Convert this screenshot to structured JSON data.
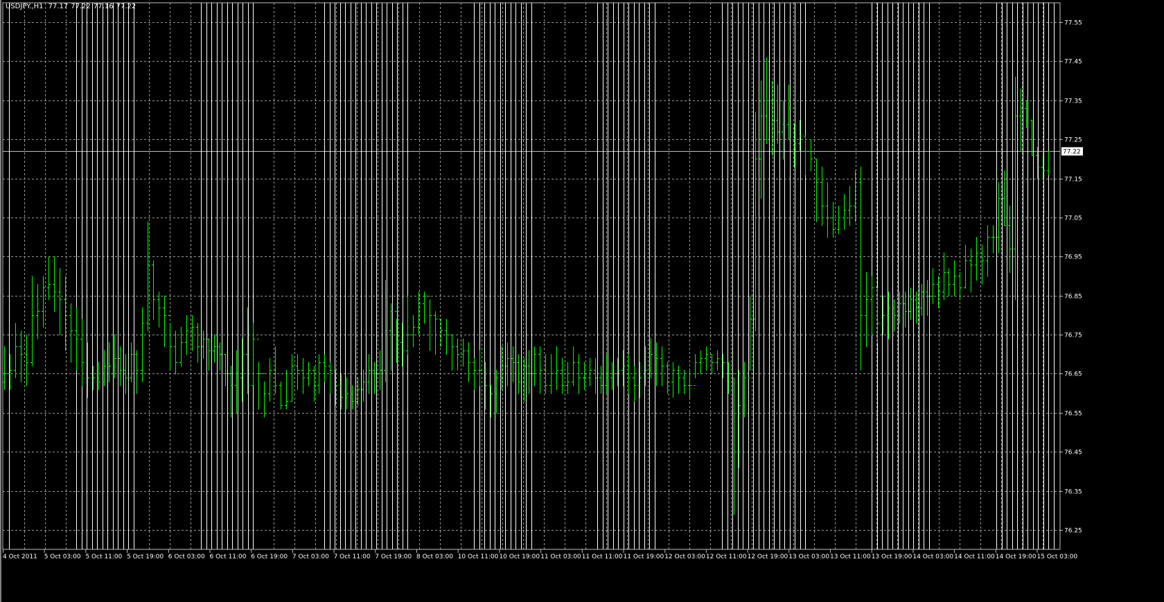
{
  "header": {
    "symbol": "USDJPY.,H1",
    "open": "77.17",
    "high": "77.22",
    "low": "77.16",
    "close": "77.22"
  },
  "colors": {
    "background": "#000000",
    "bar": "#00ff00",
    "grid": "#c0c0c0",
    "separator": "#ffffff",
    "bid_line": "#c0c0c0"
  },
  "chart_data": {
    "type": "ohlc",
    "title": "USDJPY.,H1",
    "ylim": [
      76.2,
      77.6
    ],
    "grid": true,
    "current_price": "77.22",
    "y_ticks": [
      "77.55",
      "77.45",
      "77.35",
      "77.25",
      "77.15",
      "77.05",
      "76.95",
      "76.85",
      "76.75",
      "76.65",
      "76.55",
      "76.45",
      "76.35",
      "76.25"
    ],
    "x_ticks": [
      "4 Oct 2011",
      "5 Oct 03:00",
      "5 Oct 11:00",
      "5 Oct 19:00",
      "6 Oct 03:00",
      "6 Oct 11:00",
      "6 Oct 19:00",
      "7 Oct 03:00",
      "7 Oct 11:00",
      "7 Oct 19:00",
      "8 Oct 03:00",
      "10 Oct 11:00",
      "10 Oct 19:00",
      "11 Oct 03:00",
      "11 Oct 11:00",
      "11 Oct 19:00",
      "12 Oct 03:00",
      "12 Oct 11:00",
      "12 Oct 19:00",
      "13 Oct 03:00",
      "13 Oct 11:00",
      "13 Oct 19:00",
      "14 Oct 03:00",
      "14 Oct 11:00",
      "14 Oct 19:00",
      "15 Oct 03:00"
    ],
    "first_open": 76.63,
    "bars_hlc": [
      [
        76.72,
        76.61,
        76.65
      ],
      [
        76.7,
        76.61,
        76.66
      ],
      [
        76.78,
        76.64,
        76.72
      ],
      [
        76.76,
        76.63,
        76.7
      ],
      [
        76.75,
        76.62,
        76.68
      ],
      [
        76.9,
        76.67,
        76.8
      ],
      [
        76.88,
        76.74,
        76.81
      ],
      [
        76.9,
        76.77,
        76.87
      ],
      [
        76.95,
        76.84,
        76.88
      ],
      [
        76.95,
        76.81,
        76.86
      ],
      [
        76.92,
        76.75,
        76.84
      ],
      [
        76.9,
        76.71,
        76.8
      ],
      [
        76.83,
        76.68,
        76.76
      ],
      [
        76.82,
        76.66,
        76.74
      ],
      [
        76.79,
        76.62,
        76.68
      ],
      [
        76.73,
        76.59,
        76.64
      ],
      [
        76.67,
        76.61,
        76.64
      ],
      [
        76.68,
        76.61,
        76.63
      ],
      [
        76.71,
        76.62,
        76.67
      ],
      [
        76.73,
        76.63,
        76.67
      ],
      [
        76.75,
        76.64,
        76.69
      ],
      [
        76.72,
        76.62,
        76.66
      ],
      [
        76.7,
        76.6,
        76.64
      ],
      [
        76.73,
        76.63,
        76.7
      ],
      [
        76.71,
        76.6,
        76.66
      ],
      [
        76.82,
        76.63,
        76.78
      ],
      [
        77.04,
        76.76,
        76.93
      ],
      [
        76.94,
        76.79,
        76.84
      ],
      [
        76.86,
        76.77,
        76.82
      ],
      [
        76.85,
        76.72,
        76.8
      ],
      [
        76.78,
        76.66,
        76.72
      ],
      [
        76.76,
        76.65,
        76.68
      ],
      [
        76.77,
        76.67,
        76.73
      ],
      [
        76.8,
        76.7,
        76.76
      ],
      [
        76.8,
        76.71,
        76.77
      ],
      [
        76.78,
        76.68,
        76.72
      ],
      [
        76.76,
        76.69,
        76.74
      ],
      [
        76.74,
        76.66,
        76.71
      ],
      [
        76.75,
        76.68,
        76.72
      ],
      [
        76.73,
        76.66,
        76.7
      ],
      [
        76.7,
        76.62,
        76.65
      ],
      [
        76.67,
        76.54,
        76.62
      ],
      [
        76.71,
        76.55,
        76.64
      ],
      [
        76.74,
        76.58,
        76.7
      ],
      [
        76.82,
        76.6,
        76.62
      ],
      [
        76.78,
        76.62,
        76.74
      ],
      [
        76.68,
        76.56,
        76.65
      ],
      [
        76.63,
        76.54,
        76.6
      ],
      [
        76.69,
        76.58,
        76.66
      ],
      [
        76.72,
        76.6,
        76.62
      ],
      [
        76.63,
        76.56,
        76.57
      ],
      [
        76.66,
        76.56,
        76.58
      ],
      [
        76.7,
        76.58,
        76.67
      ],
      [
        76.7,
        76.61,
        76.66
      ],
      [
        76.69,
        76.6,
        76.64
      ],
      [
        76.68,
        76.62,
        76.66
      ],
      [
        76.67,
        76.58,
        76.62
      ],
      [
        76.7,
        76.6,
        76.68
      ],
      [
        76.7,
        76.63,
        76.67
      ],
      [
        76.68,
        76.6,
        76.66
      ],
      [
        76.66,
        76.57,
        76.62
      ],
      [
        76.65,
        76.56,
        76.59
      ],
      [
        76.64,
        76.56,
        76.6
      ],
      [
        76.62,
        76.56,
        76.58
      ],
      [
        76.64,
        76.57,
        76.61
      ],
      [
        76.66,
        76.58,
        76.63
      ],
      [
        76.7,
        76.6,
        76.66
      ],
      [
        76.68,
        76.6,
        76.65
      ],
      [
        76.71,
        76.61,
        76.66
      ],
      [
        76.89,
        76.63,
        76.76
      ],
      [
        76.83,
        76.66,
        76.81
      ],
      [
        76.79,
        76.68,
        76.73
      ],
      [
        76.78,
        76.67,
        76.71
      ],
      [
        76.85,
        76.7,
        76.75
      ],
      [
        76.8,
        76.72,
        76.77
      ],
      [
        76.86,
        76.75,
        76.83
      ],
      [
        76.86,
        76.78,
        76.85
      ],
      [
        76.84,
        76.71,
        76.8
      ],
      [
        76.81,
        76.7,
        76.79
      ],
      [
        76.79,
        76.72,
        76.76
      ],
      [
        76.79,
        76.7,
        76.75
      ],
      [
        76.75,
        76.66,
        76.72
      ],
      [
        76.74,
        76.66,
        76.7
      ],
      [
        76.74,
        76.67,
        76.71
      ],
      [
        76.73,
        76.63,
        76.68
      ],
      [
        76.69,
        76.61,
        76.66
      ],
      [
        76.71,
        76.62,
        76.66
      ],
      [
        76.68,
        76.56,
        76.62
      ],
      [
        76.62,
        76.54,
        76.6
      ],
      [
        76.66,
        76.55,
        76.64
      ],
      [
        76.72,
        76.61,
        76.67
      ],
      [
        76.73,
        76.62,
        76.69
      ],
      [
        76.72,
        76.63,
        76.68
      ],
      [
        76.7,
        76.6,
        76.63
      ],
      [
        76.69,
        76.58,
        76.67
      ],
      [
        76.71,
        76.6,
        76.65
      ],
      [
        76.72,
        76.62,
        76.7
      ],
      [
        76.72,
        76.6,
        76.66
      ],
      [
        76.7,
        76.6,
        76.62
      ],
      [
        76.7,
        76.6,
        76.65
      ],
      [
        76.72,
        76.61,
        76.66
      ],
      [
        76.69,
        76.6,
        76.62
      ],
      [
        76.68,
        76.6,
        76.63
      ],
      [
        76.72,
        76.62,
        76.68
      ],
      [
        76.7,
        76.6,
        76.64
      ],
      [
        76.68,
        76.61,
        76.64
      ],
      [
        76.69,
        76.62,
        76.66
      ],
      [
        76.69,
        76.6,
        76.64
      ],
      [
        76.67,
        76.6,
        76.62
      ],
      [
        76.7,
        76.6,
        76.64
      ],
      [
        76.68,
        76.61,
        76.65
      ],
      [
        76.69,
        76.62,
        76.66
      ],
      [
        76.71,
        76.62,
        76.67
      ],
      [
        76.7,
        76.6,
        76.64
      ],
      [
        76.67,
        76.58,
        76.62
      ],
      [
        76.68,
        76.59,
        76.64
      ],
      [
        76.72,
        76.62,
        76.66
      ],
      [
        76.74,
        76.64,
        76.7
      ],
      [
        76.73,
        76.62,
        76.69
      ],
      [
        76.72,
        76.62,
        76.67
      ],
      [
        76.68,
        76.6,
        76.63
      ],
      [
        76.68,
        76.59,
        76.66
      ],
      [
        76.67,
        76.6,
        76.64
      ],
      [
        76.66,
        76.6,
        76.62
      ],
      [
        76.66,
        76.59,
        76.62
      ],
      [
        76.7,
        76.64,
        76.68
      ],
      [
        76.71,
        76.65,
        76.69
      ],
      [
        76.72,
        76.66,
        76.7
      ],
      [
        76.7,
        76.65,
        76.68
      ],
      [
        76.71,
        76.66,
        76.69
      ],
      [
        76.7,
        76.64,
        76.68
      ],
      [
        76.68,
        76.6,
        76.65
      ],
      [
        76.64,
        76.29,
        76.45
      ],
      [
        76.66,
        76.41,
        76.57
      ],
      [
        76.68,
        76.54,
        76.64
      ],
      [
        76.85,
        76.66,
        76.79
      ],
      [
        77.32,
        76.76,
        77.2
      ],
      [
        77.4,
        77.1,
        77.31
      ],
      [
        77.46,
        77.24,
        77.35
      ],
      [
        77.4,
        77.21,
        77.3
      ],
      [
        77.39,
        77.24,
        77.27
      ],
      [
        77.35,
        77.2,
        77.29
      ],
      [
        77.39,
        77.25,
        77.33
      ],
      [
        77.29,
        77.18,
        77.24
      ],
      [
        77.3,
        77.22,
        77.26
      ],
      [
        77.26,
        77.16,
        77.22
      ],
      [
        77.25,
        77.17,
        77.2
      ],
      [
        77.2,
        77.04,
        77.14
      ],
      [
        77.18,
        77.03,
        77.08
      ],
      [
        77.14,
        77.0,
        77.05
      ],
      [
        77.09,
        77.0,
        77.02
      ],
      [
        77.08,
        77.01,
        77.05
      ],
      [
        77.11,
        77.02,
        77.07
      ],
      [
        77.13,
        77.03,
        77.08
      ],
      [
        77.17,
        77.04,
        77.14
      ],
      [
        77.18,
        76.66,
        76.8
      ],
      [
        76.91,
        76.72,
        76.84
      ],
      [
        76.9,
        76.75,
        76.87
      ],
      [
        76.87,
        76.73,
        76.78
      ],
      [
        76.85,
        76.75,
        76.8
      ],
      [
        76.86,
        76.74,
        76.82
      ],
      [
        76.84,
        76.76,
        76.8
      ],
      [
        76.86,
        76.78,
        76.83
      ],
      [
        76.86,
        76.77,
        76.81
      ],
      [
        76.87,
        76.79,
        76.84
      ],
      [
        76.86,
        76.78,
        76.82
      ],
      [
        76.88,
        76.8,
        76.86
      ],
      [
        76.89,
        76.8,
        76.85
      ],
      [
        76.92,
        76.83,
        76.88
      ],
      [
        76.9,
        76.82,
        76.86
      ],
      [
        76.96,
        76.84,
        76.91
      ],
      [
        76.92,
        76.85,
        76.88
      ],
      [
        76.94,
        76.85,
        76.9
      ],
      [
        76.91,
        76.84,
        76.87
      ],
      [
        76.98,
        76.87,
        76.94
      ],
      [
        76.97,
        76.86,
        76.93
      ],
      [
        77.0,
        76.89,
        76.96
      ],
      [
        76.98,
        76.88,
        76.94
      ],
      [
        77.03,
        76.9,
        77.0
      ],
      [
        77.03,
        76.96,
        77.0
      ],
      [
        77.14,
        76.96,
        77.1
      ],
      [
        77.17,
        77.03,
        77.03
      ],
      [
        77.08,
        76.91,
        76.97
      ],
      [
        77.41,
        76.84,
        77.31
      ],
      [
        77.38,
        77.22,
        77.33
      ],
      [
        77.35,
        77.28,
        77.3
      ],
      [
        77.3,
        77.21,
        77.21
      ],
      [
        77.23,
        77.15,
        77.18
      ],
      [
        77.21,
        77.15,
        77.17
      ],
      [
        77.22,
        77.16,
        77.22
      ]
    ]
  }
}
